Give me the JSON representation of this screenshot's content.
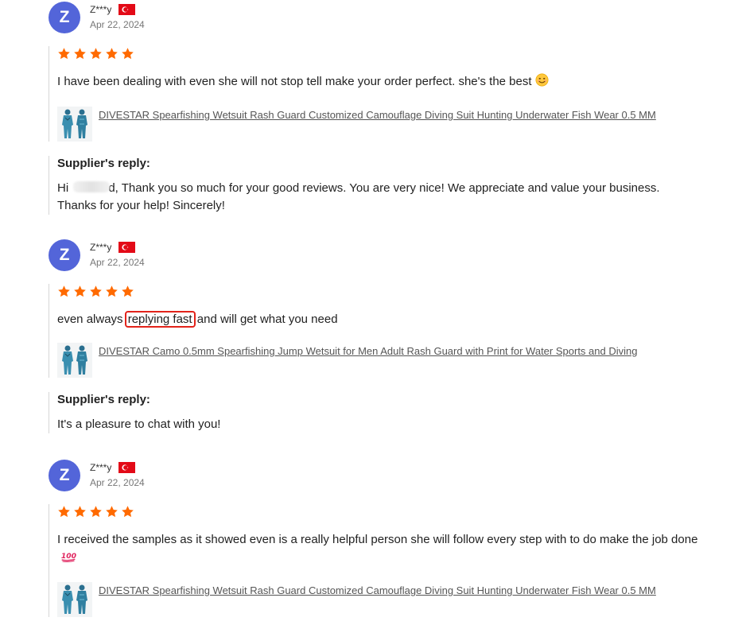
{
  "reviews": [
    {
      "avatar_letter": "Z",
      "name": "Z***y",
      "country_flag": "turkey-flag-icon",
      "date": "Apr 22, 2024",
      "rating": 5,
      "text": "I have been dealing with even she will not stop tell make your order perfect. she's the best",
      "emoji": "smiling-face-icon",
      "product_name": "DIVESTAR Spearfishing Wetsuit Rash Guard Customized Camouflage Diving Suit Hunting Underwater Fish Wear 0.5 MM",
      "reply": {
        "title": "Supplier's reply:",
        "text_before": "Hi ",
        "text_after": "d, Thank you so much for your good reviews. You are very nice! We appreciate and value your business. Thanks for your help! Sincerely!"
      }
    },
    {
      "avatar_letter": "Z",
      "name": "Z***y",
      "country_flag": "turkey-flag-icon",
      "date": "Apr 22, 2024",
      "rating": 5,
      "text_before": "even always ",
      "text_highlight": "replying fast",
      "text_after": " and will get what you need",
      "product_name": "DIVESTAR Camo 0.5mm Spearfishing Jump Wetsuit for Men Adult Rash Guard with Print for Water Sports and Diving",
      "reply": {
        "title": "Supplier's reply:",
        "text": "It's a pleasure to chat with you!"
      }
    },
    {
      "avatar_letter": "Z",
      "name": "Z***y",
      "country_flag": "turkey-flag-icon",
      "date": "Apr 22, 2024",
      "rating": 5,
      "text": "I received the samples as it showed even is a really helpful person she will follow every step with to do make the job done",
      "emoji": "hundred-points-icon",
      "product_name": "DIVESTAR Spearfishing Wetsuit Rash Guard Customized Camouflage Diving Suit Hunting Underwater Fish Wear 0.5 MM"
    }
  ],
  "colors": {
    "avatar": "#5365d9",
    "star": "#ff6a00",
    "highlight_border": "#e2231a",
    "flag": "#e30a17"
  }
}
